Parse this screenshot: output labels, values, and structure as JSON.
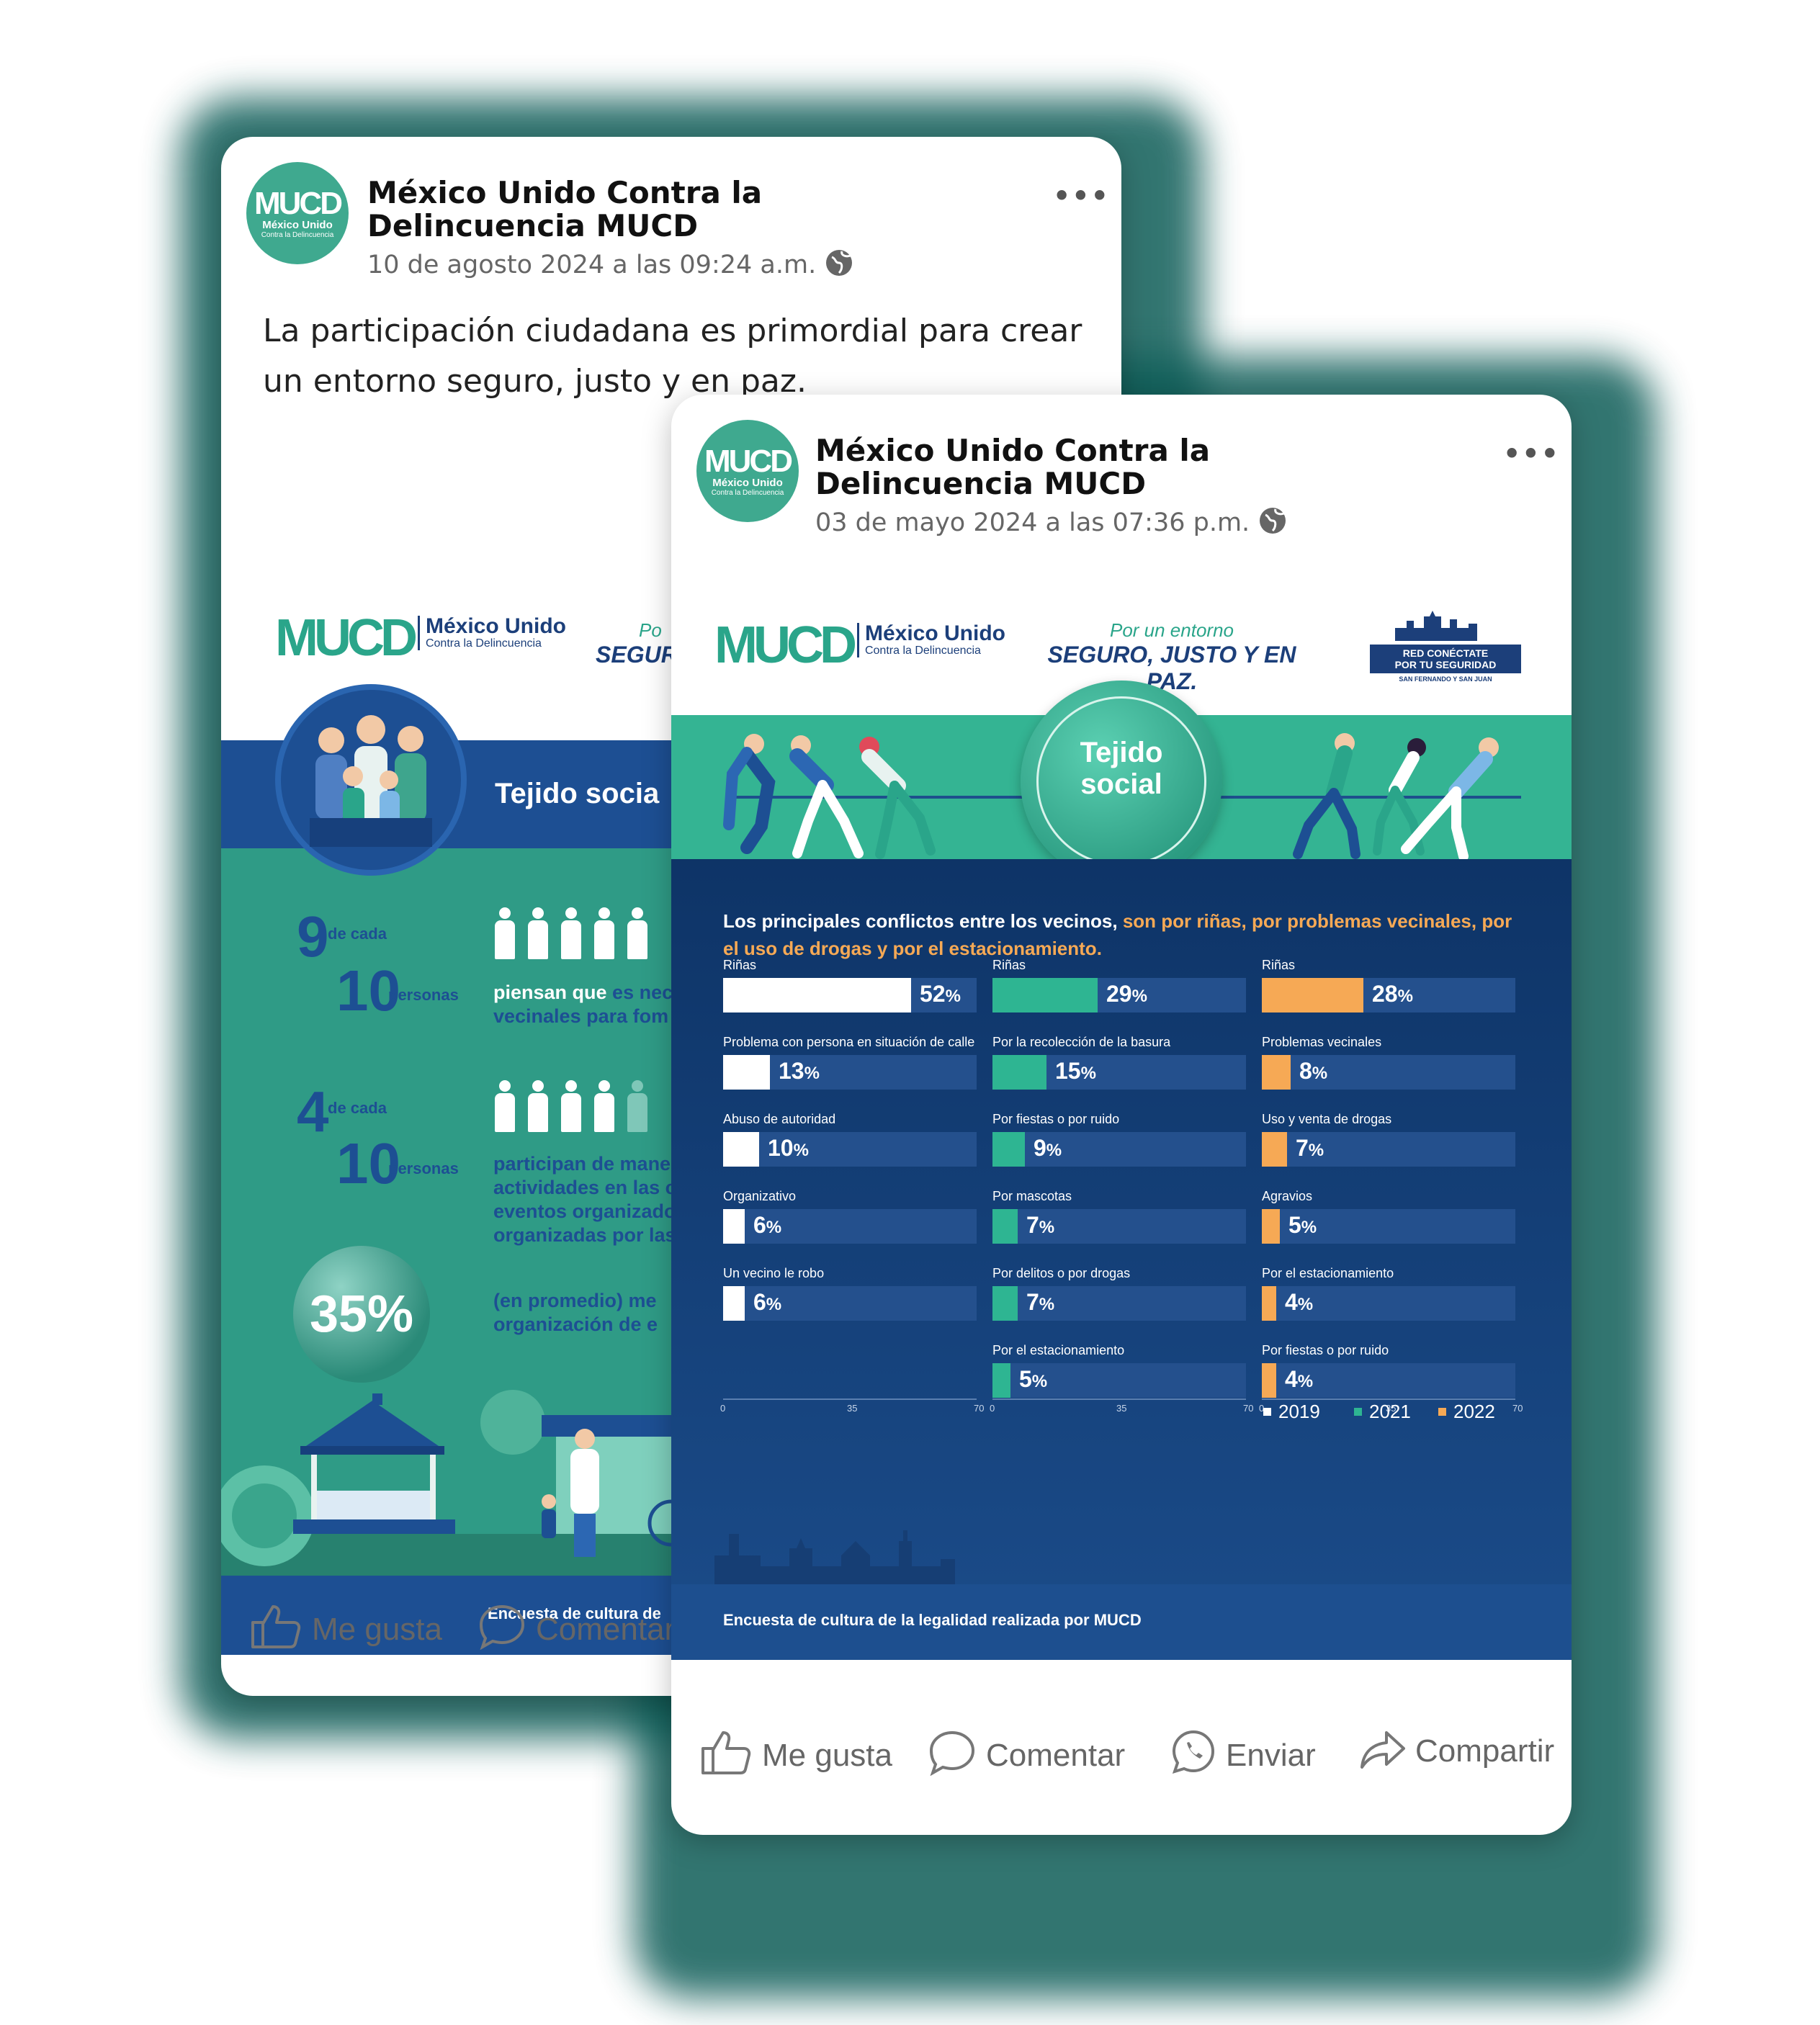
{
  "back_post": {
    "page_name": "México Unido Contra la Delincuencia MUCD",
    "date": "10 de agosto 2024 a las 09:24 a.m.",
    "text": "La participación ciudadana es primordial para crear un entorno seguro, justo y en paz.",
    "avatar": {
      "mark": "MUCD",
      "line1": "México Unido",
      "line2": "Contra la Delincuencia"
    },
    "infographic": {
      "logo_mark": "MUCD",
      "logo_line1": "México Unido",
      "logo_line2": "Contra la Delincuencia",
      "slogan_fragment_1": "Po",
      "slogan_fragment_2": "SEGURO",
      "title": "Tejido socia",
      "stat1_num": "9",
      "stat1_small_top": "de cada",
      "stat1_den": "10",
      "stat1_small_bottom": "personas",
      "stat1_text_a": "piensan que ",
      "stat1_text_hl": "es nec",
      "stat1_text_b": "vecinales para fom",
      "stat2_num": "4",
      "stat2_small_top": "de cada",
      "stat2_den": "10",
      "stat2_small_bottom": "personas",
      "stat2_lines": [
        "participan de mane",
        "actividades en las c",
        "eventos organizado",
        "organizadas por las"
      ],
      "stat3_value": "35%",
      "stat3_lines": [
        "(en promedio) me",
        "organización de e"
      ],
      "footer": "Encuesta de cultura de"
    },
    "actions": {
      "like": "Me gusta",
      "comment": "Comentar"
    }
  },
  "front_post": {
    "page_name": "México Unido Contra la Delincuencia MUCD",
    "date": "03 de mayo 2024 a las 07:36 p.m.",
    "avatar": {
      "mark": "MUCD",
      "line1": "México Unido",
      "line2": "Contra la Delincuencia"
    },
    "infographic": {
      "logo_mark": "MUCD",
      "logo_line1": "México Unido",
      "logo_line2": "Contra la Delincuencia",
      "slogan_line1": "Por un entorno",
      "slogan_line2": "SEGURO, JUSTO Y EN PAZ.",
      "badge_line1": "RED CONÉCTATE",
      "badge_line2": "POR TU SEGURIDAD",
      "badge_sub": "SAN FERNANDO Y SAN JUAN",
      "title_line1": "Tejido",
      "title_line2": "social",
      "headline_a": "Los principales conflictos entre los vecinos, ",
      "headline_b": "son por riñas, por problemas vecinales, por el uso de drogas y por el estacionamiento.",
      "footer": "Encuesta de cultura de la legalidad realizada por MUCD"
    },
    "actions": {
      "like": "Me gusta",
      "comment": "Comentar",
      "send": "Enviar",
      "share": "Compartir"
    }
  },
  "colors": {
    "series_2019": "#ffffff",
    "series_2021": "#2eb592",
    "series_2022": "#f6a955",
    "navy": "#0f3668",
    "green": "#34b493"
  },
  "chart_data": {
    "type": "bar",
    "orientation": "horizontal",
    "xlim": [
      0,
      70
    ],
    "ticks": [
      "0",
      "35",
      "70"
    ],
    "value_suffix": "%",
    "legend": [
      "2019",
      "2021",
      "2022"
    ],
    "panels": [
      {
        "name": "2019",
        "categories": [
          "Riñas",
          "Problema con persona en situación de calle",
          "Abuso de autoridad",
          "Organizativo",
          "Un vecino le robo"
        ],
        "values": [
          52,
          13,
          10,
          6,
          6
        ]
      },
      {
        "name": "2021",
        "categories": [
          "Riñas",
          "Por la recolección de la basura",
          "Por fiestas o por ruido",
          "Por mascotas",
          "Por delitos o por drogas",
          "Por el estacionamiento"
        ],
        "values": [
          29,
          15,
          9,
          7,
          7,
          5
        ]
      },
      {
        "name": "2022",
        "categories": [
          "Riñas",
          "Problemas vecinales",
          "Uso y venta de drogas",
          "Agravios",
          "Por el estacionamiento",
          "Por fiestas o por ruido"
        ],
        "values": [
          28,
          8,
          7,
          5,
          4,
          4
        ]
      }
    ]
  }
}
